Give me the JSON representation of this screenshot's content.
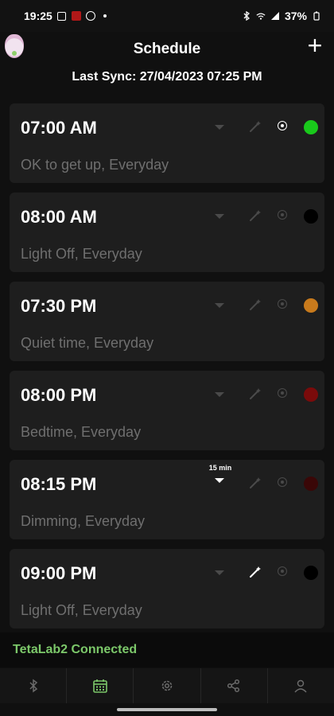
{
  "status_bar": {
    "time": "19:25",
    "battery": "37%"
  },
  "header": {
    "title": "Schedule",
    "add_label": "+"
  },
  "sync": {
    "text": "Last Sync: 27/04/2023 07:25 PM"
  },
  "schedules": [
    {
      "time": "07:00 AM",
      "description": "OK to get up, Everyday",
      "color": "#19c91b",
      "selected": true
    },
    {
      "time": "08:00 AM",
      "description": "Light Off, Everyday",
      "color": "#000000",
      "selected": false
    },
    {
      "time": "07:30 PM",
      "description": "Quiet time, Everyday",
      "color": "#c87a1c",
      "selected": false
    },
    {
      "time": "08:00 PM",
      "description": "Bedtime, Everyday",
      "color": "#7a0b0b",
      "selected": false
    },
    {
      "time": "08:15 PM",
      "description": "Dimming, Everyday",
      "color": "#3a0707",
      "selected": false,
      "duration": "15 min"
    },
    {
      "time": "09:00 PM",
      "description": "Light Off, Everyday",
      "color": "#000000",
      "selected": false,
      "wand_active": true
    }
  ],
  "connection": {
    "text": "TetaLab2 Connected"
  },
  "nav": {
    "items": [
      "bluetooth-icon",
      "calendar-icon",
      "gear-icon",
      "share-icon",
      "user-icon"
    ],
    "active": "calendar-icon",
    "accent": "#7cc86a"
  }
}
